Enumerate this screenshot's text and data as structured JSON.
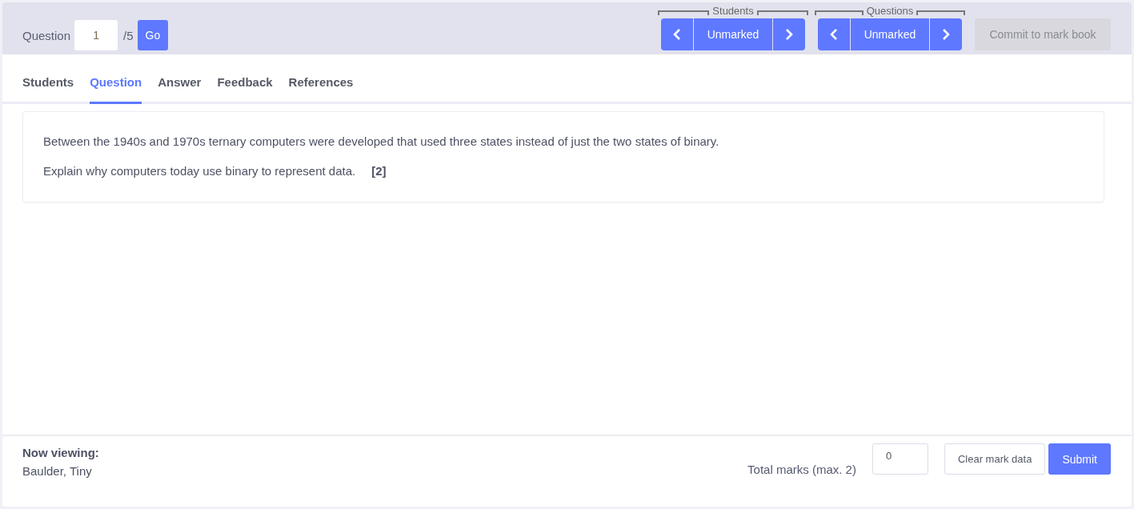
{
  "question_nav": {
    "label": "Question",
    "value": "1",
    "total": "/5",
    "go": "Go"
  },
  "navigators": [
    {
      "legend": "Students",
      "status": "Unmarked"
    },
    {
      "legend": "Questions",
      "status": "Unmarked"
    }
  ],
  "commit_button": {
    "label": "Commit to mark book",
    "disabled": true
  },
  "tabs": [
    {
      "label": "Students",
      "selected": false
    },
    {
      "label": "Question",
      "selected": true
    },
    {
      "label": "Answer",
      "selected": false
    },
    {
      "label": "Feedback",
      "selected": false
    },
    {
      "label": "References",
      "selected": false
    }
  ],
  "question": {
    "paragraphs": [
      "Between the 1940s and 1970s ternary computers were developed that used three states instead of just the two states of binary.",
      "Explain why computers today use binary to represent data."
    ],
    "marks": "[2]"
  },
  "footer": {
    "viewing_label": "Now viewing:",
    "student": "Baulder, Tiny",
    "total_label": "Total marks (max. 2)",
    "total_value": "0",
    "clear_button": "Clear mark data",
    "submit_button": "Submit"
  }
}
